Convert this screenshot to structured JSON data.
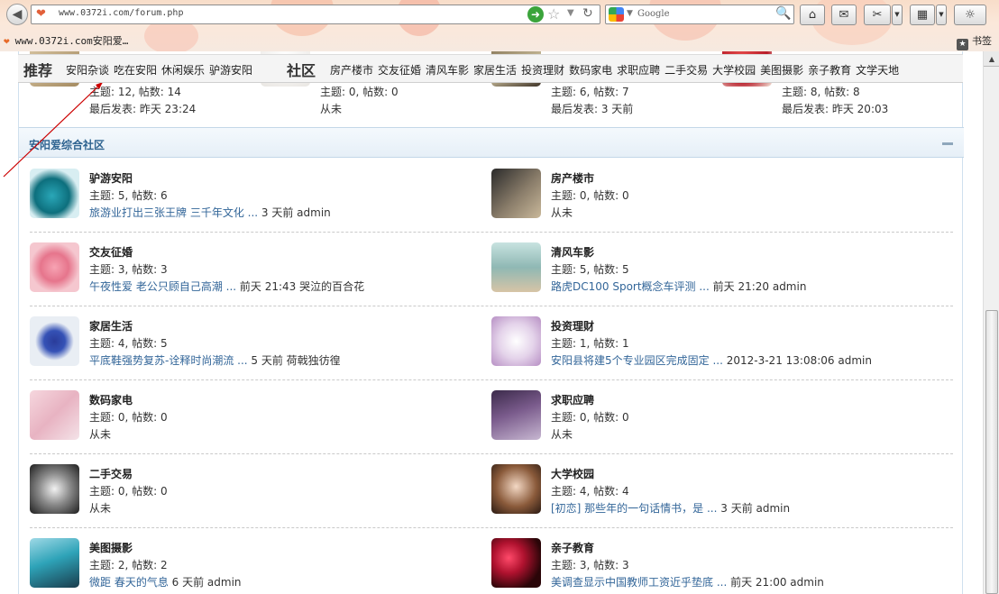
{
  "browser": {
    "url": "www.0372i.com/forum.php",
    "search_placeholder": "Google",
    "bookmark_label": "www.0372i.com安阳爱…",
    "bookmarks_menu": "书签"
  },
  "quick_nav": {
    "group1_title": "推荐",
    "group1_links": [
      "安阳杂谈",
      "吃在安阳",
      "休闲娱乐",
      "驴游安阳"
    ],
    "group2_title": "社区",
    "group2_links": [
      "房产楼市",
      "交友征婚",
      "清风车影",
      "家居生活",
      "投资理财",
      "数码家电",
      "求职应聘",
      "二手交易",
      "大学校园",
      "美图摄影",
      "亲子教育",
      "文学天地"
    ]
  },
  "partial_row": [
    {
      "stat": "主题: 12, 帖数: 14",
      "last": "最后发表: 昨天 23:24"
    },
    {
      "stat": "主题: 0, 帖数: 0",
      "last": "从未"
    },
    {
      "stat": "主题: 6, 帖数: 7",
      "last": "最后发表: 3 天前"
    },
    {
      "stat": "主题: 8, 帖数: 8",
      "last": "最后发表: 昨天 20:03"
    }
  ],
  "category": {
    "title": "安阳爱综合社区"
  },
  "forums": [
    {
      "name": "驴游安阳",
      "stat": "主题: 5, 帖数: 6",
      "last_link": "旅游业打出三张王牌 三千年文化 ...",
      "last_meta": " 3 天前 admin"
    },
    {
      "name": "房产楼市",
      "stat": "主题: 0, 帖数: 0",
      "last_link": "",
      "last_meta": "从未"
    },
    {
      "name": "交友征婚",
      "stat": "主题: 3, 帖数: 3",
      "last_link": "午夜性爱 老公只顾自己高潮 ...",
      "last_meta": " 前天 21:43 哭泣的百合花"
    },
    {
      "name": "清风车影",
      "stat": "主题: 5, 帖数: 5",
      "last_link": "路虎DC100 Sport概念车评测 ...",
      "last_meta": " 前天 21:20 admin"
    },
    {
      "name": "家居生活",
      "stat": "主题: 4, 帖数: 5",
      "last_link": "平底鞋强势复苏-诠释时尚潮流 ...",
      "last_meta": " 5 天前 荷戟独彷徨"
    },
    {
      "name": "投资理财",
      "stat": "主题: 1, 帖数: 1",
      "last_link": "安阳县将建5个专业园区完成固定 ...",
      "last_meta": " 2012-3-21 13:08:06 admin"
    },
    {
      "name": "数码家电",
      "stat": "主题: 0, 帖数: 0",
      "last_link": "",
      "last_meta": "从未"
    },
    {
      "name": "求职应聘",
      "stat": "主题: 0, 帖数: 0",
      "last_link": "",
      "last_meta": "从未"
    },
    {
      "name": "二手交易",
      "stat": "主题: 0, 帖数: 0",
      "last_link": "",
      "last_meta": "从未"
    },
    {
      "name": "大学校园",
      "stat": "主题: 4, 帖数: 4",
      "last_link": "[初恋] 那些年的一句话情书，是 ...",
      "last_meta": " 3 天前 admin"
    },
    {
      "name": "美图摄影",
      "stat": "主题: 2, 帖数: 2",
      "last_link": "微距 春天的气息",
      "last_meta": " 6 天前 admin"
    },
    {
      "name": "亲子教育",
      "stat": "主题: 3, 帖数: 3",
      "last_link": "美调查显示中国教师工资近乎垫底 ...",
      "last_meta": " 前天 21:00 admin"
    }
  ],
  "colors": {
    "link": "#336699",
    "category_title": "#2e6390",
    "annotation": "#cc0000"
  }
}
